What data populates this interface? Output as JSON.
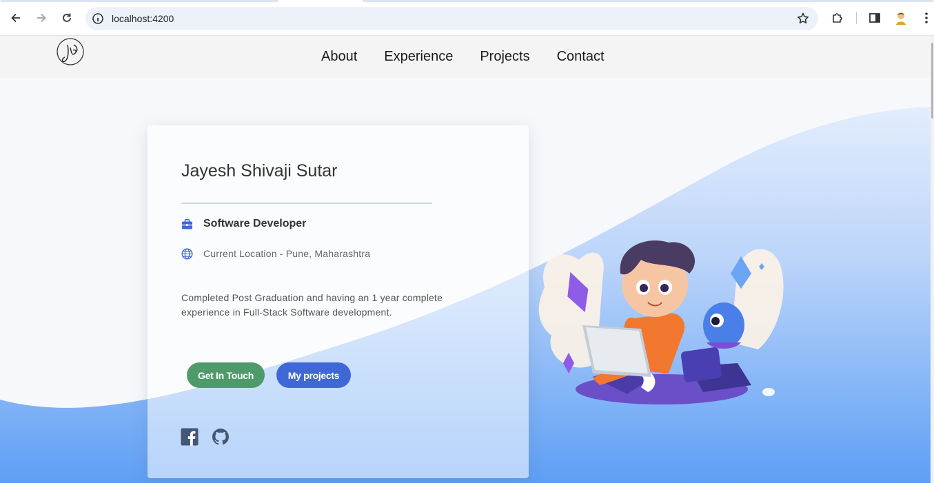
{
  "browser": {
    "url": "localhost:4200"
  },
  "header": {
    "nav": [
      "About",
      "Experience",
      "Projects",
      "Contact"
    ]
  },
  "profile": {
    "name": "Jayesh Shivaji Sutar",
    "role": "Software Developer",
    "location": "Current Location - Pune, Maharashtra",
    "description": "Completed Post Graduation and having an 1 year complete experience in Full-Stack Software development.",
    "buttons": {
      "contact": "Get In Touch",
      "projects": "My projects"
    }
  },
  "icons": {
    "role": "briefcase-icon",
    "location": "globe-icon",
    "social": [
      "facebook-icon",
      "github-icon"
    ]
  },
  "colors": {
    "accent_blue": "#3f67d6",
    "accent_green": "#4e9a6b",
    "wave_light": "#dbe7fb",
    "wave_dark": "#5e9ff5"
  }
}
